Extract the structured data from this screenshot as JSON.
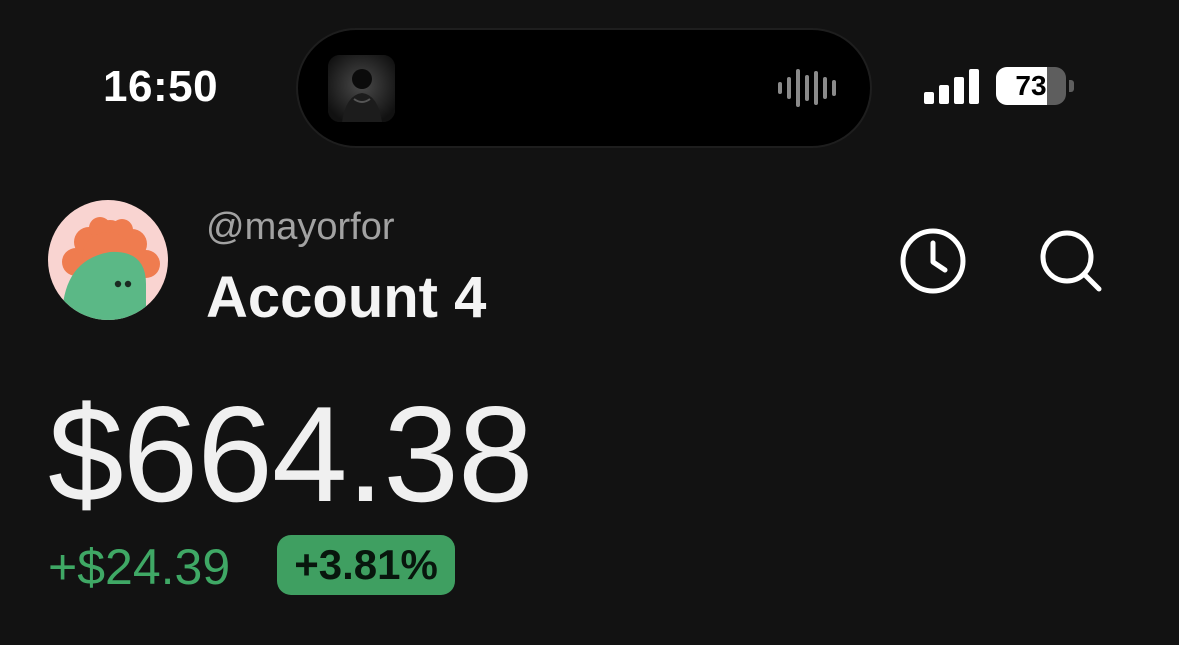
{
  "status_bar": {
    "time": "16:50",
    "battery_level": "73",
    "signal_icon": "cellular-signal-icon",
    "battery_icon": "battery-icon"
  },
  "dynamic_island": {
    "activity_icon": "audio-waveform-icon"
  },
  "account": {
    "username": "@mayorfor",
    "name": "Account 4",
    "avatar_colors": {
      "background": "#f9d4d1",
      "petals": "#ef7c4f",
      "body": "#5bb886"
    }
  },
  "header_actions": {
    "history_icon": "clock-icon",
    "search_icon": "search-icon"
  },
  "portfolio": {
    "balance": "$664.38",
    "change_amount": "+$24.39",
    "change_percent": "+3.81%",
    "positive_color": "#3fa865"
  }
}
